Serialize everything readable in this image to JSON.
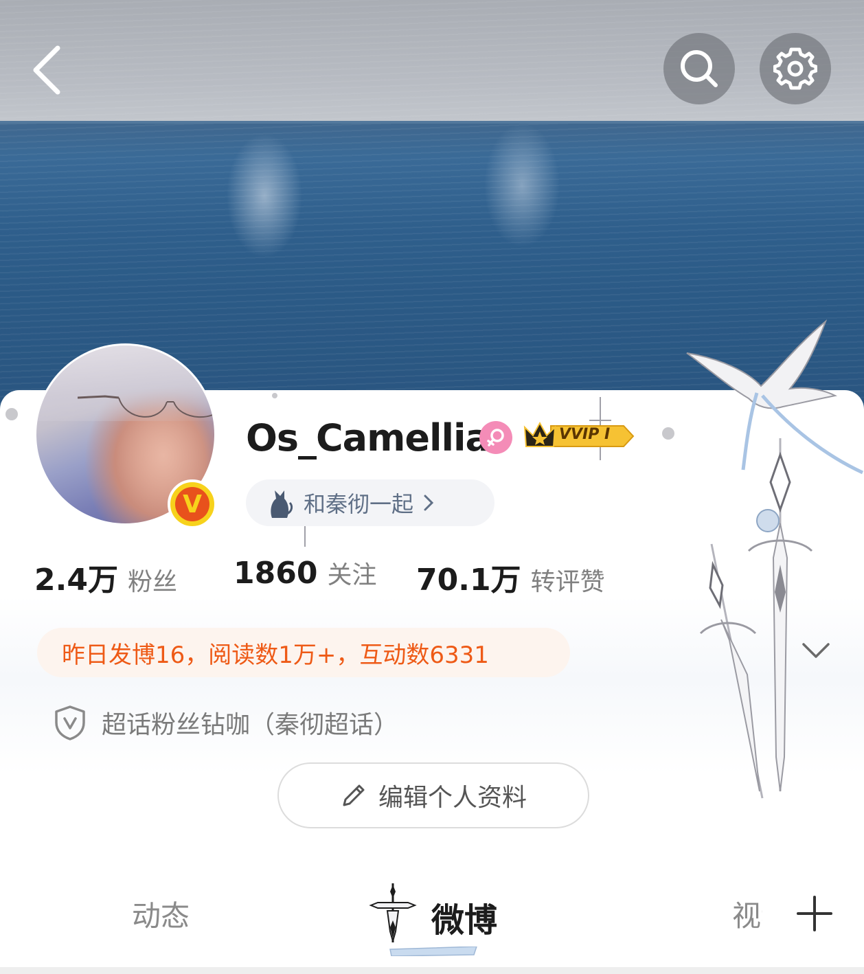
{
  "colors": {
    "accent_orange": "#ee5a16",
    "verified_yellow": "#f7d21c",
    "verified_red": "#e8511c",
    "gender_pink": "#f48cb7",
    "vvip_gold": "#f6c233"
  },
  "header": {
    "back_icon": "chevron-left-icon",
    "search_icon": "search-icon",
    "settings_icon": "gear-icon"
  },
  "profile": {
    "username": "Os_Camellia",
    "verified_badge": "V",
    "vvip_label": "VVIP Ⅰ",
    "super_topic": "和秦彻一起",
    "stats": [
      {
        "value": "2.4万",
        "label": "粉丝"
      },
      {
        "value": "1860",
        "label": "关注"
      },
      {
        "value": "70.1万",
        "label": "转评赞"
      }
    ],
    "activity": "昨日发博16，阅读数1万+，互动数6331",
    "fan_title": "超话粉丝钻咖（秦彻超话）",
    "edit_button": "编辑个人资料"
  },
  "tabs": [
    {
      "label": "动态",
      "active": false
    },
    {
      "label": "微博",
      "active": true
    },
    {
      "label": "视频",
      "active": false
    }
  ]
}
